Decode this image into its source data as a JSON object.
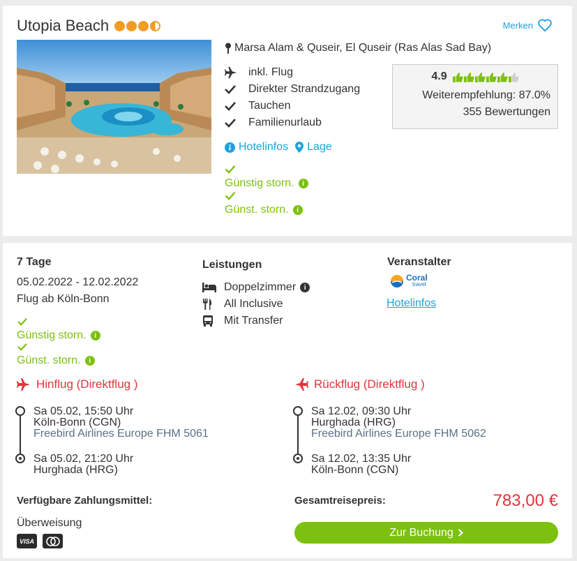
{
  "hotel": {
    "name": "Utopia Beach",
    "sun_rating": 3.5,
    "merken_label": "Merken",
    "location": "Marsa Alam & Quseir, El Quseir (Ras Alas Sad Bay)",
    "features": [
      "inkl. Flug",
      "Direkter Strandzugang",
      "Tauchen",
      "Familienurlaub"
    ],
    "hotelinfos_label": "Hotelinfos",
    "lage_label": "Lage",
    "storn_1": "Günstig storn.",
    "storn_2": "Günst. storn.",
    "rating": {
      "score": "4.9",
      "thumbs": 5.5,
      "recommendation": "Weiterempfehlung: 87.0%",
      "reviews": "355 Bewertungen"
    }
  },
  "offer": {
    "duration": "7 Tage",
    "dates": "05.02.2022 - 12.02.2022",
    "departure": "Flug ab Köln-Bonn",
    "storn_1": "Günstig storn.",
    "storn_2": "Günst. storn.",
    "leistungen_title": "Leistungen",
    "leistungen": [
      "Doppelzimmer",
      "All Inclusive",
      "Mit Transfer"
    ],
    "veranstalter_title": "Veranstalter",
    "veranstalter_logo": "Coral",
    "veranstalter_logo_sub": "travel",
    "veranstalter_link": "Hotelinfos"
  },
  "hinflug": {
    "title": "Hinflug (Direktflug )",
    "dep_time": "Sa 05.02, 15:50 Uhr",
    "dep_airport": "Köln-Bonn (CGN)",
    "airline": "Freebird Airlines Europe FHM 5061",
    "arr_time": "Sa 05.02, 21:20 Uhr",
    "arr_airport": "Hurghada (HRG)"
  },
  "rueckflug": {
    "title": "Rückflug (Direktflug )",
    "dep_time": "Sa 12.02, 09:30 Uhr",
    "dep_airport": "Hurghada (HRG)",
    "airline": "Freebird Airlines Europe FHM 5062",
    "arr_time": "Sa 12.02, 13:35 Uhr",
    "arr_airport": "Köln-Bonn (CGN)"
  },
  "payment": {
    "title": "Verfügbare Zahlungsmittel:",
    "method": "Überweisung",
    "cards": [
      "VISA",
      "Mastercard"
    ]
  },
  "total": {
    "label": "Gesamtreisepreis:",
    "price": "783,00 €",
    "button": "Zur Buchung"
  },
  "colors": {
    "accent_blue": "#1aa3dd",
    "green": "#7cc110",
    "red": "#e2333a",
    "sun_orange": "#f39c23"
  }
}
